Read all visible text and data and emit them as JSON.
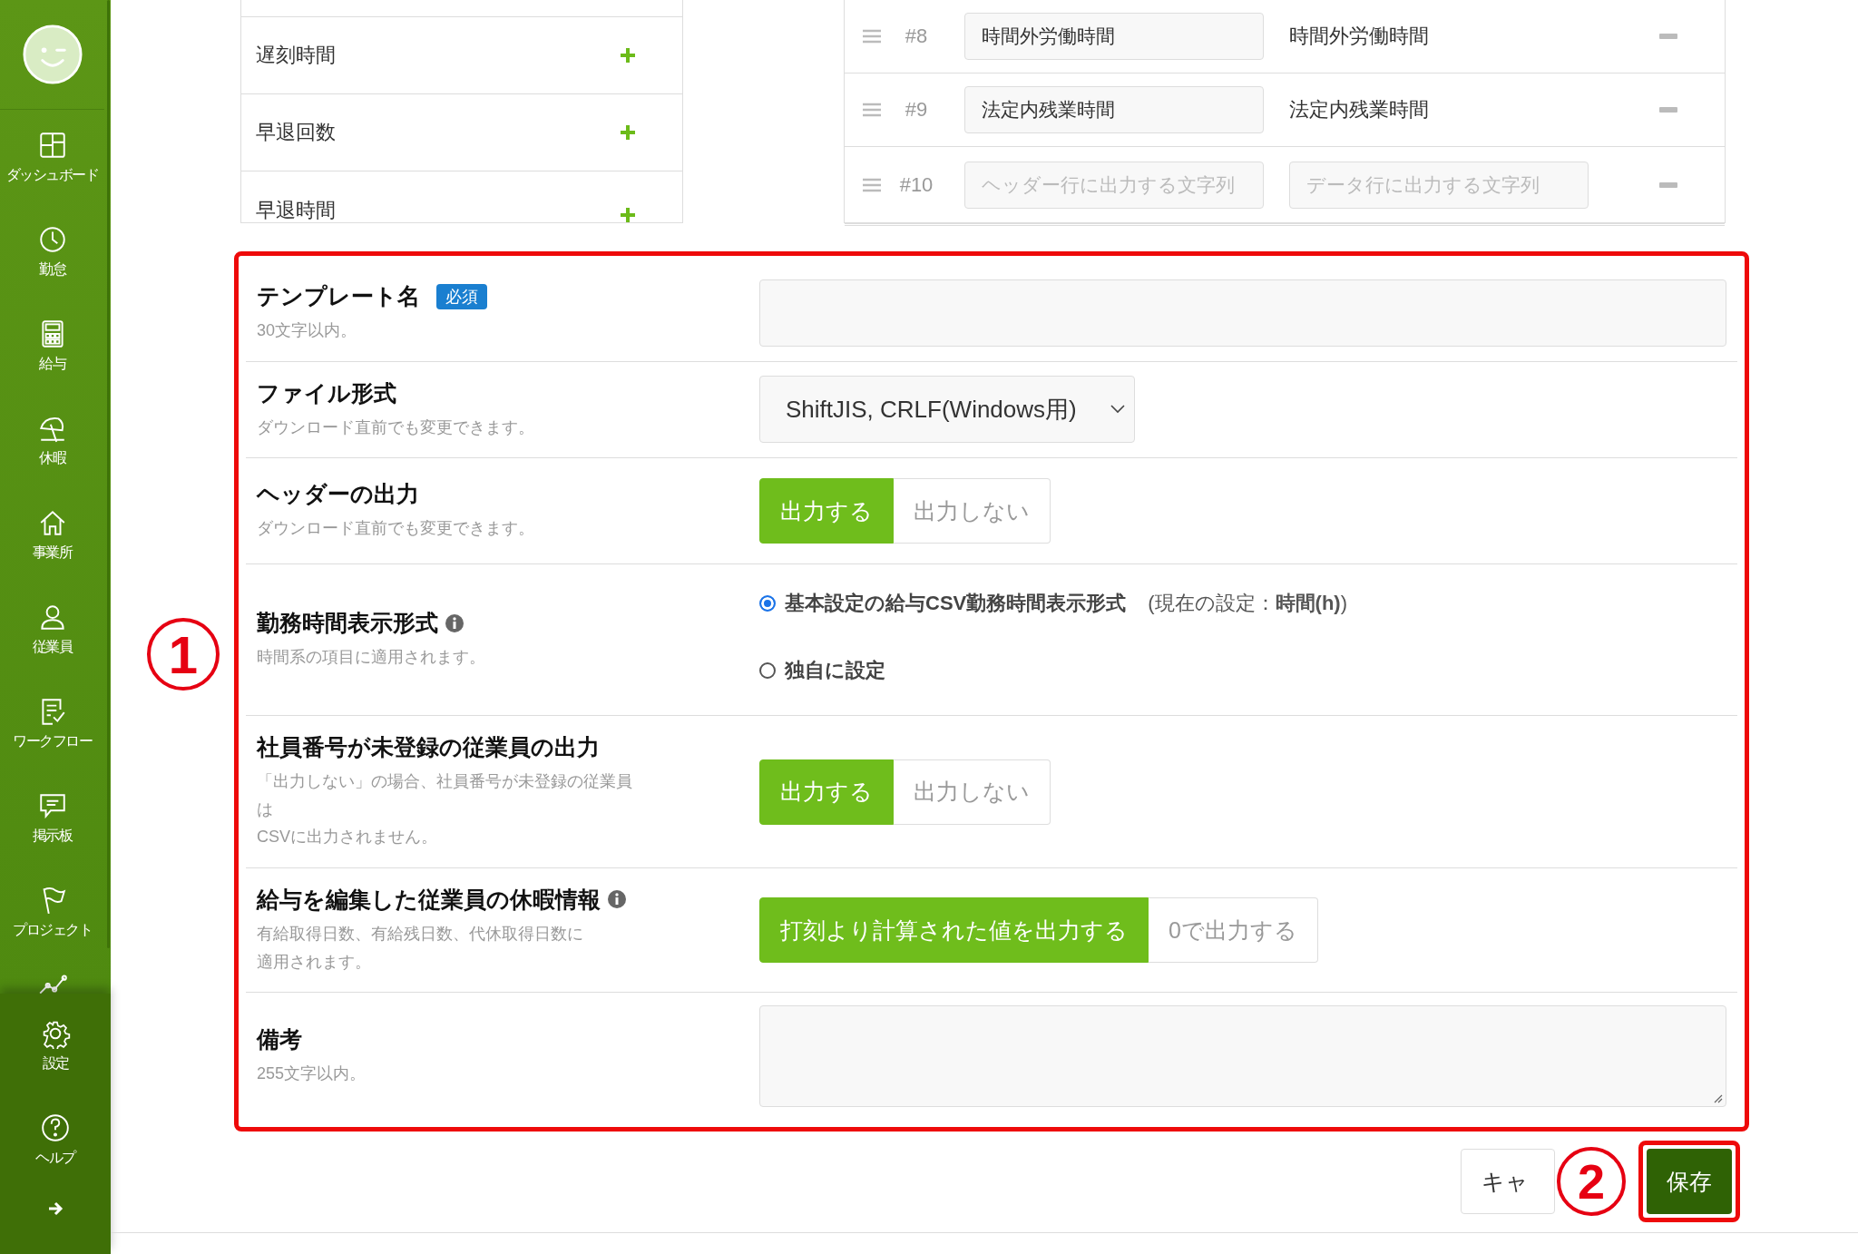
{
  "sidebar": {
    "nav_items": [
      {
        "kind": "dashboard",
        "label": "ダッシュボード"
      },
      {
        "kind": "clock",
        "label": "勤怠"
      },
      {
        "kind": "calculator",
        "label": "給与"
      },
      {
        "kind": "parasol",
        "label": "休暇"
      },
      {
        "kind": "house",
        "label": "事業所"
      },
      {
        "kind": "person",
        "label": "従業員"
      },
      {
        "kind": "checklist",
        "label": "ワークフロー"
      },
      {
        "kind": "chat",
        "label": "掲示板"
      },
      {
        "kind": "flag",
        "label": "プロジェクト"
      },
      {
        "kind": "chart"
      }
    ],
    "bottom_items": [
      {
        "kind": "gear",
        "label": "設定"
      },
      {
        "kind": "help",
        "label": "ヘルプ"
      }
    ]
  },
  "field_list": {
    "rows": [
      {
        "label": "遅刻時間"
      },
      {
        "label": "早退回数"
      },
      {
        "label": "早退時間"
      }
    ]
  },
  "column_table": {
    "rows": [
      {
        "kind": "filled",
        "number": "#8",
        "header_value": "時間外労働時間",
        "data_text": "時間外労働時間"
      },
      {
        "kind": "filled",
        "number": "#9",
        "header_value": "法定内残業時間",
        "data_text": "法定内残業時間"
      },
      {
        "kind": "empty",
        "number": "#10",
        "header_placeholder": "ヘッダー行に出力する文字列",
        "data_placeholder": "データ行に出力する文字列"
      }
    ]
  },
  "form": {
    "rows": [
      {
        "kind": "text_input",
        "label": "テンプレート名",
        "required_badge": "必須",
        "info": false,
        "hint": [
          "30文字以内。"
        ]
      },
      {
        "kind": "select",
        "label": "ファイル形式",
        "info": false,
        "hint": [
          "ダウンロード直前でも変更できます。"
        ],
        "value": "ShiftJIS, CRLF(Windows用)"
      },
      {
        "kind": "toggle",
        "label": "ヘッダーの出力",
        "info": false,
        "hint": [
          "ダウンロード直前でも変更できます。"
        ],
        "options": [
          {
            "label": "出力する",
            "selected": true
          },
          {
            "label": "出力しない",
            "selected": false
          }
        ]
      },
      {
        "kind": "radio",
        "label": "勤務時間表示形式",
        "info": true,
        "hint": [
          "時間系の項目に適用されます。"
        ],
        "options": [
          {
            "label": "基本設定の給与CSV勤務時間表示形式",
            "note": "(現在の設定：**時間(h)**)",
            "selected": true
          },
          {
            "label": "独自に設定",
            "selected": false
          }
        ]
      },
      {
        "kind": "toggle",
        "label": "社員番号が未登録の従業員の出力",
        "info": false,
        "hint": [
          "「出力しない」の場合、社員番号が未登録の従業員",
          "は",
          "CSVに出力されません。"
        ],
        "options": [
          {
            "label": "出力する",
            "selected": true
          },
          {
            "label": "出力しない",
            "selected": false
          }
        ]
      },
      {
        "kind": "toggle",
        "label": "給与を編集した従業員の休暇情報",
        "info": true,
        "hint": [
          "有給取得日数、有給残日数、代休取得日数に",
          "適用されます。"
        ],
        "options": [
          {
            "label": "打刻より計算された値を出力する",
            "selected": true
          },
          {
            "label": "0で出力する",
            "selected": false
          }
        ]
      },
      {
        "kind": "textarea",
        "label": "備考",
        "info": false,
        "hint": [
          "255文字以内。"
        ]
      }
    ]
  },
  "footer": {
    "cancel_button": "キャ",
    "save_button": "保存"
  },
  "annotations": [
    {
      "text": "1"
    },
    {
      "text": "2"
    }
  ]
}
